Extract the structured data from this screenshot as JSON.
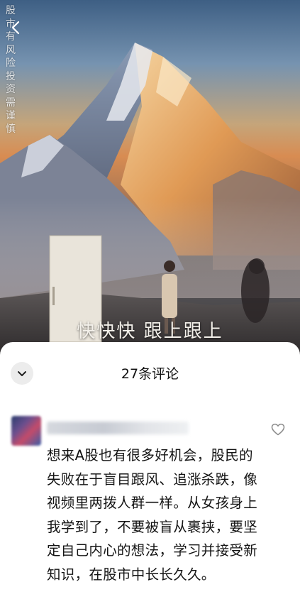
{
  "video": {
    "caption": "快快快 跟上跟上",
    "risk_warning": "股市有风险 投资需谨慎"
  },
  "icons": {
    "back": "back-chevron-icon",
    "collapse": "chevron-down-icon",
    "like": "heart-icon"
  },
  "comments_panel": {
    "title": "27条评论",
    "comments": [
      {
        "text": "想来A股也有很多好机会，股民的失败在于盲目跟风、追涨杀跌，像视频里两拨人群一样。从女孩身上我学到了，不要被盲从裹挟，要坚定自己内心的想法，学习并接受新知识，在股市中长长久久。"
      }
    ]
  }
}
